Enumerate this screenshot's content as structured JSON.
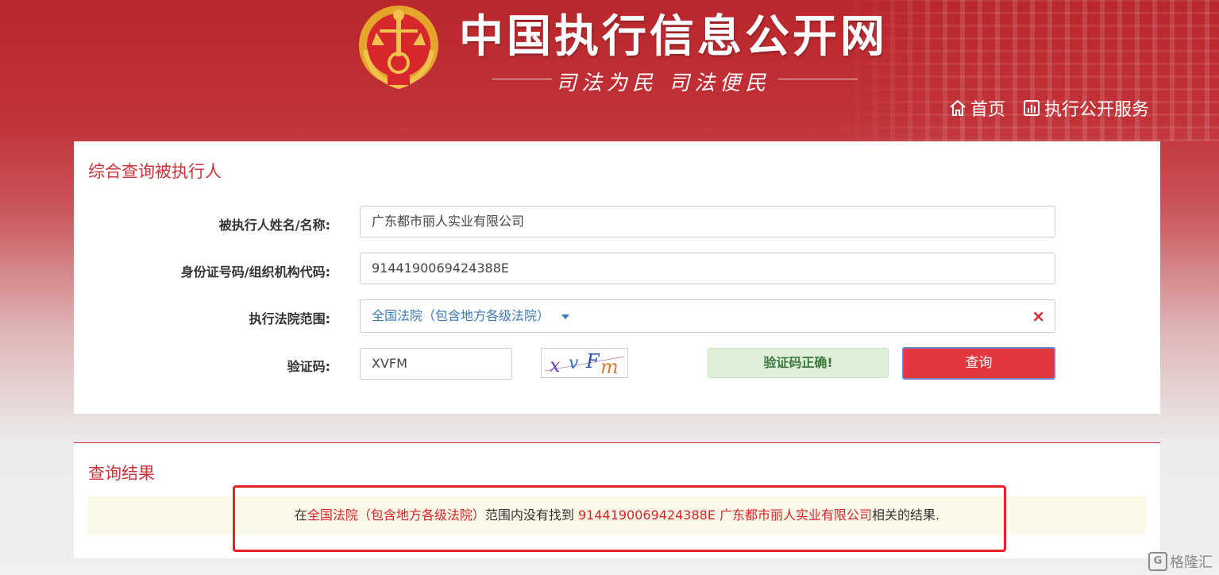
{
  "header": {
    "site_title": "中国执行信息公开网",
    "slogan": "司法为民  司法便民",
    "emblem_icon": "court-emblem-icon",
    "nav": [
      {
        "label": "首页",
        "icon": "home-icon"
      },
      {
        "label": "执行公开服务",
        "icon": "bar-chart-icon"
      }
    ]
  },
  "search": {
    "title": "综合查询被执行人",
    "name_label": "被执行人姓名/名称:",
    "name_value": "广东都市丽人实业有限公司",
    "id_label": "身份证号码/组织机构代码:",
    "id_value": "9144190069424388E",
    "court_label": "执行法院范围:",
    "court_value": "全国法院（包含地方各级法院）",
    "captcha_label": "验证码:",
    "captcha_value": "XVFM",
    "captcha_image_text": "xvFm",
    "captcha_status": "验证码正确!",
    "query_button": "查询",
    "clear_symbol": "×"
  },
  "result": {
    "title": "查询结果",
    "prefix": "在",
    "court": "全国法院（包含地方各级法院）",
    "middle": "范围内没有找到 ",
    "keywords": "9144190069424388E 广东都市丽人实业有限公司",
    "suffix": "相关的结果."
  },
  "watermark": {
    "logo": "G",
    "text": "格隆汇"
  },
  "colors": {
    "brand_red": "#c9353b",
    "button_red": "#e2383d",
    "success_bg": "#dff0d8",
    "notice_bg": "#fcf8e7",
    "link_blue": "#3b79b5"
  }
}
